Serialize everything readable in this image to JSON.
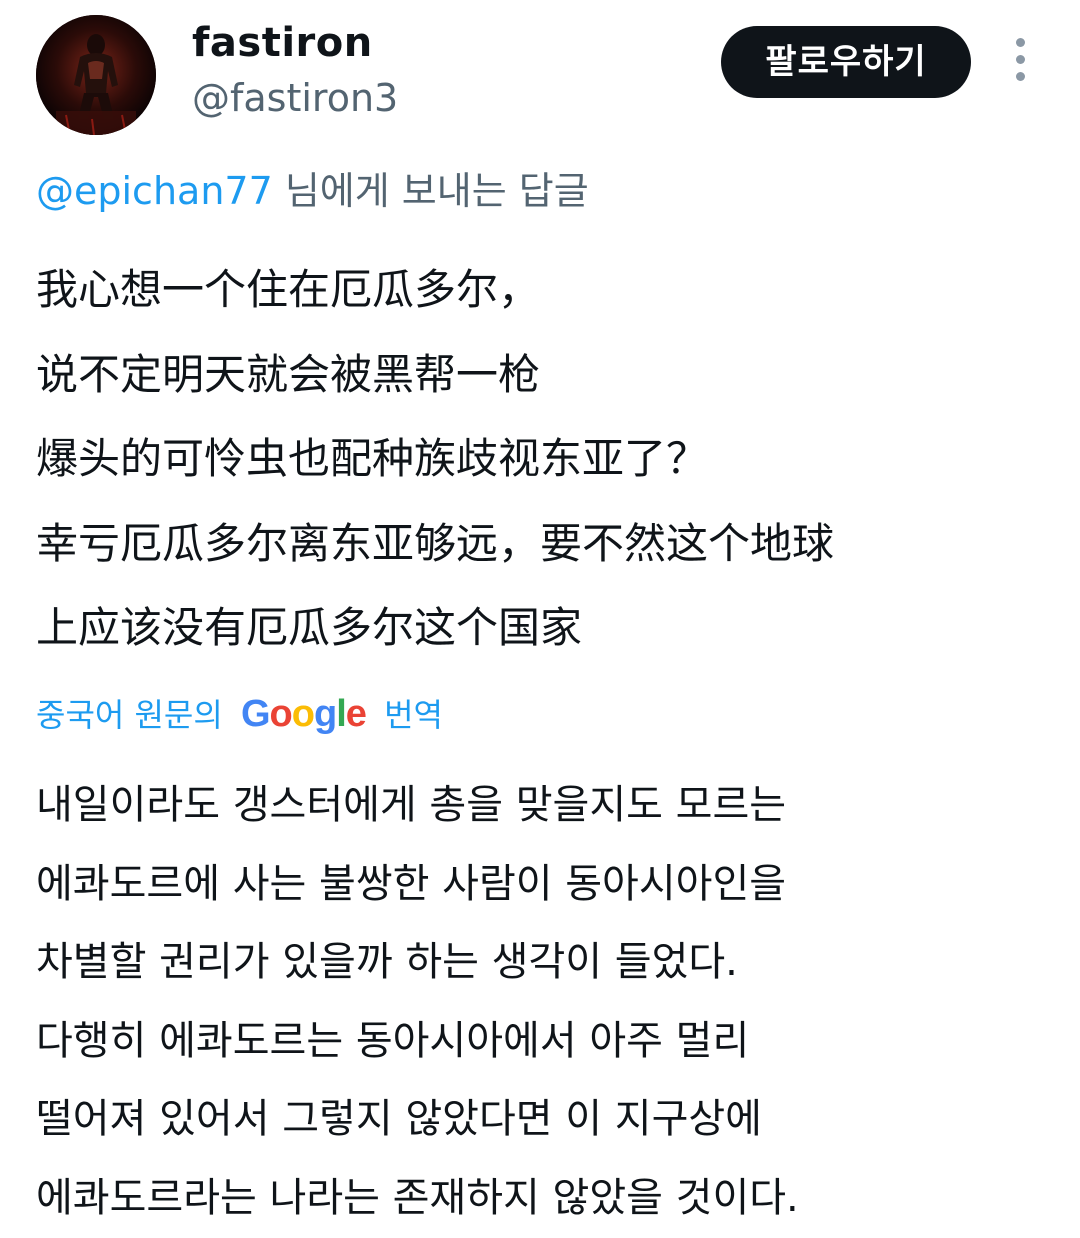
{
  "author": {
    "display_name": "fastiron",
    "handle": "@fastiron3"
  },
  "follow_button": {
    "label": "팔로우하기"
  },
  "reply_context": {
    "mention": "@epichan77",
    "suffix": " 님에게 보내는 답글"
  },
  "tweet": {
    "lines": [
      "我心想一个住在厄瓜多尔，",
      "说不定明天就会被黑帮一枪",
      "爆头的可怜虫也配种族歧视东亚了？",
      "幸亏厄瓜多尔离东亚够远，要不然这个地球",
      "上应该没有厄瓜多尔这个国家"
    ]
  },
  "translation": {
    "prefix": "중국어 원문의",
    "brand": "Google",
    "suffix": "번역",
    "brand_colors": [
      "#4285F4",
      "#EA4335",
      "#FBBC05",
      "#4285F4",
      "#34A853",
      "#EA4335"
    ],
    "lines": [
      "내일이라도 갱스터에게 총을 맞을지도 모르는",
      "에콰도르에 사는 불쌍한 사람이 동아시아인을",
      "차별할 권리가 있을까 하는 생각이 들었다.",
      "다행히 에콰도르는 동아시아에서 아주 멀리",
      "떨어져 있어서 그렇지 않았다면 이 지구상에",
      "에콰도르라는 나라는 존재하지 않았을 것이다."
    ]
  },
  "colors": {
    "text_primary": "#0f1419",
    "text_secondary": "#536471",
    "link_blue": "#1d9bf0",
    "button_bg": "#0f1419"
  },
  "icons": {
    "more": "more-vertical-icon"
  }
}
